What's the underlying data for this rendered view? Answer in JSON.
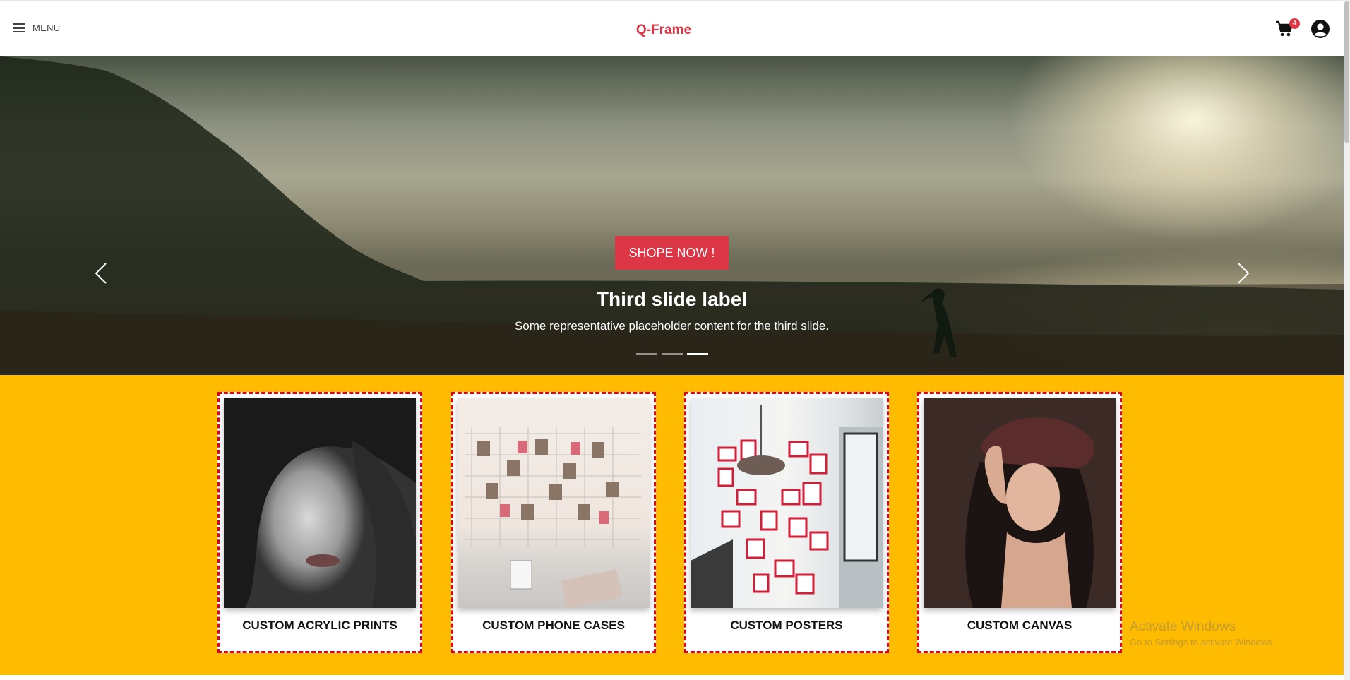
{
  "header": {
    "menu_label": "MENU",
    "brand": "Q-Frame",
    "cart_count": "4",
    "brand_color": "#dc3545"
  },
  "hero": {
    "button_label": "SHOPE NOW !",
    "title": "Third slide label",
    "text": "Some representative placeholder content for the third slide.",
    "indicators": [
      "slide-1",
      "slide-2",
      "slide-3"
    ],
    "active_index": 2
  },
  "categories": [
    {
      "label": "CUSTOM ACRYLIC PRINTS"
    },
    {
      "label": "CUSTOM PHONE CASES"
    },
    {
      "label": "CUSTOM POSTERS"
    },
    {
      "label": "CUSTOM CANVAS"
    }
  ],
  "watermark": {
    "line1": "Activate Windows",
    "line2": "Go to Settings to activate Windows."
  },
  "colors": {
    "accent": "#dc3545",
    "band": "#ffbb00",
    "card_border": "#e0001a"
  }
}
